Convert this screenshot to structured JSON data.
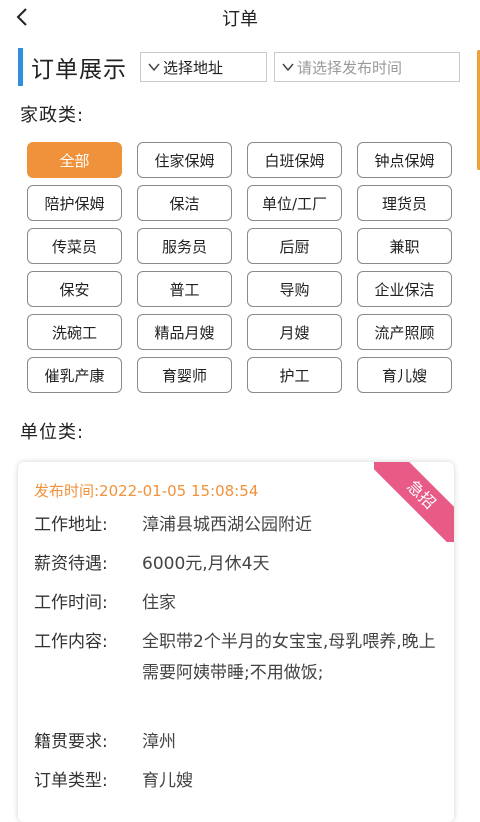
{
  "header": {
    "title": "订单"
  },
  "section": {
    "title": "订单展示"
  },
  "filters": {
    "address_label": "选择地址",
    "time_placeholder": "请选择发布时间"
  },
  "categories": {
    "housekeeping_label": "家政类:",
    "unit_label": "单位类:",
    "chips": [
      "全部",
      "住家保姆",
      "白班保姆",
      "钟点保姆",
      "陪护保姆",
      "保洁",
      "单位/工厂",
      "理货员",
      "传菜员",
      "服务员",
      "后厨",
      "兼职",
      "保安",
      "普工",
      "导购",
      "企业保洁",
      "洗碗工",
      "精品月嫂",
      "月嫂",
      "流产照顾",
      "催乳产康",
      "育婴师",
      "护工",
      "育儿嫂"
    ],
    "active_index": 0
  },
  "order": {
    "ribbon": "急招",
    "publish_time": "发布时间:2022-01-05 15:08:54",
    "fields": [
      {
        "label": "工作地址:",
        "value": "漳浦县城西湖公园附近"
      },
      {
        "label": "薪资待遇:",
        "value": "6000元,月休4天"
      },
      {
        "label": "工作时间:",
        "value": "住家"
      },
      {
        "label": "工作内容:",
        "value": "全职带2个半月的女宝宝,母乳喂养,晚上需要阿姨带睡;不用做饭;"
      },
      {
        "label": "籍贯要求:",
        "value": "漳州"
      },
      {
        "label": "订单类型:",
        "value": "育儿嫂"
      }
    ]
  },
  "colors": {
    "accent_orange": "#f0923b",
    "section_bar_blue": "#2f8ee0",
    "ribbon_pink": "#e85b86"
  }
}
